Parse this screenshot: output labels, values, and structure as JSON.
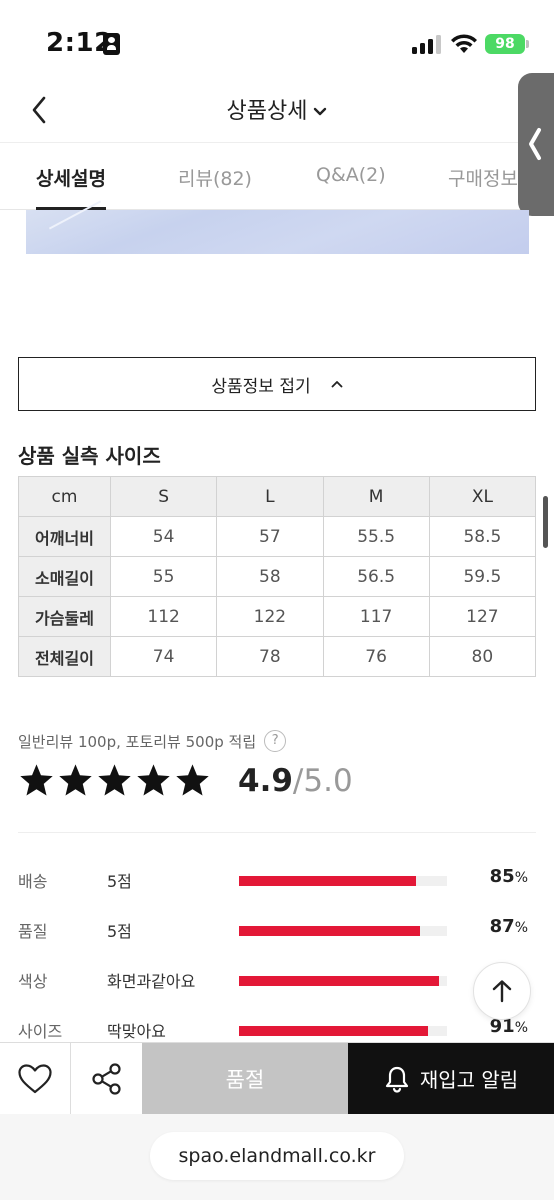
{
  "status_bar": {
    "time": "2:12",
    "battery": "98"
  },
  "header": {
    "title": "상품상세"
  },
  "tabs": [
    {
      "label": "상세설명"
    },
    {
      "label": "리뷰(82)"
    },
    {
      "label": "Q&A(2)"
    },
    {
      "label": "구매정보"
    }
  ],
  "fold_button": {
    "label": "상품정보 접기"
  },
  "size_section": {
    "title": "상품 실측 사이즈",
    "columns": [
      "cm",
      "S",
      "L",
      "M",
      "XL"
    ],
    "rows": [
      {
        "name": "어깨너비",
        "values": [
          "54",
          "57",
          "55.5",
          "58.5"
        ]
      },
      {
        "name": "소매길이",
        "values": [
          "55",
          "58",
          "56.5",
          "59.5"
        ]
      },
      {
        "name": "가슴둘레",
        "values": [
          "112",
          "122",
          "117",
          "127"
        ]
      },
      {
        "name": "전체길이",
        "values": [
          "74",
          "78",
          "76",
          "80"
        ]
      }
    ]
  },
  "review_summary": {
    "note": "일반리뷰 100p, 포토리뷰 500p 적립",
    "help": "?",
    "rating": "4.9",
    "rating_max": "/5.0",
    "stars": 5,
    "criteria": [
      {
        "label": "배송",
        "value": "5점",
        "percent": 85,
        "percent_text": "85"
      },
      {
        "label": "품질",
        "value": "5점",
        "percent": 87,
        "percent_text": "87"
      },
      {
        "label": "색상",
        "value": "화면과같아요",
        "percent": 96,
        "percent_text": ""
      },
      {
        "label": "사이즈",
        "value": "딱맞아요",
        "percent": 91,
        "percent_text": "91"
      }
    ],
    "percent_unit": "%"
  },
  "bottom_bar": {
    "soldout_label": "품절",
    "restock_label": "재입고 알림"
  },
  "browser": {
    "url": "spao.elandmall.co.kr"
  },
  "colors": {
    "accent_red": "#e31837",
    "button_dark": "#111111",
    "soldout_gray": "#c4c4c4"
  }
}
